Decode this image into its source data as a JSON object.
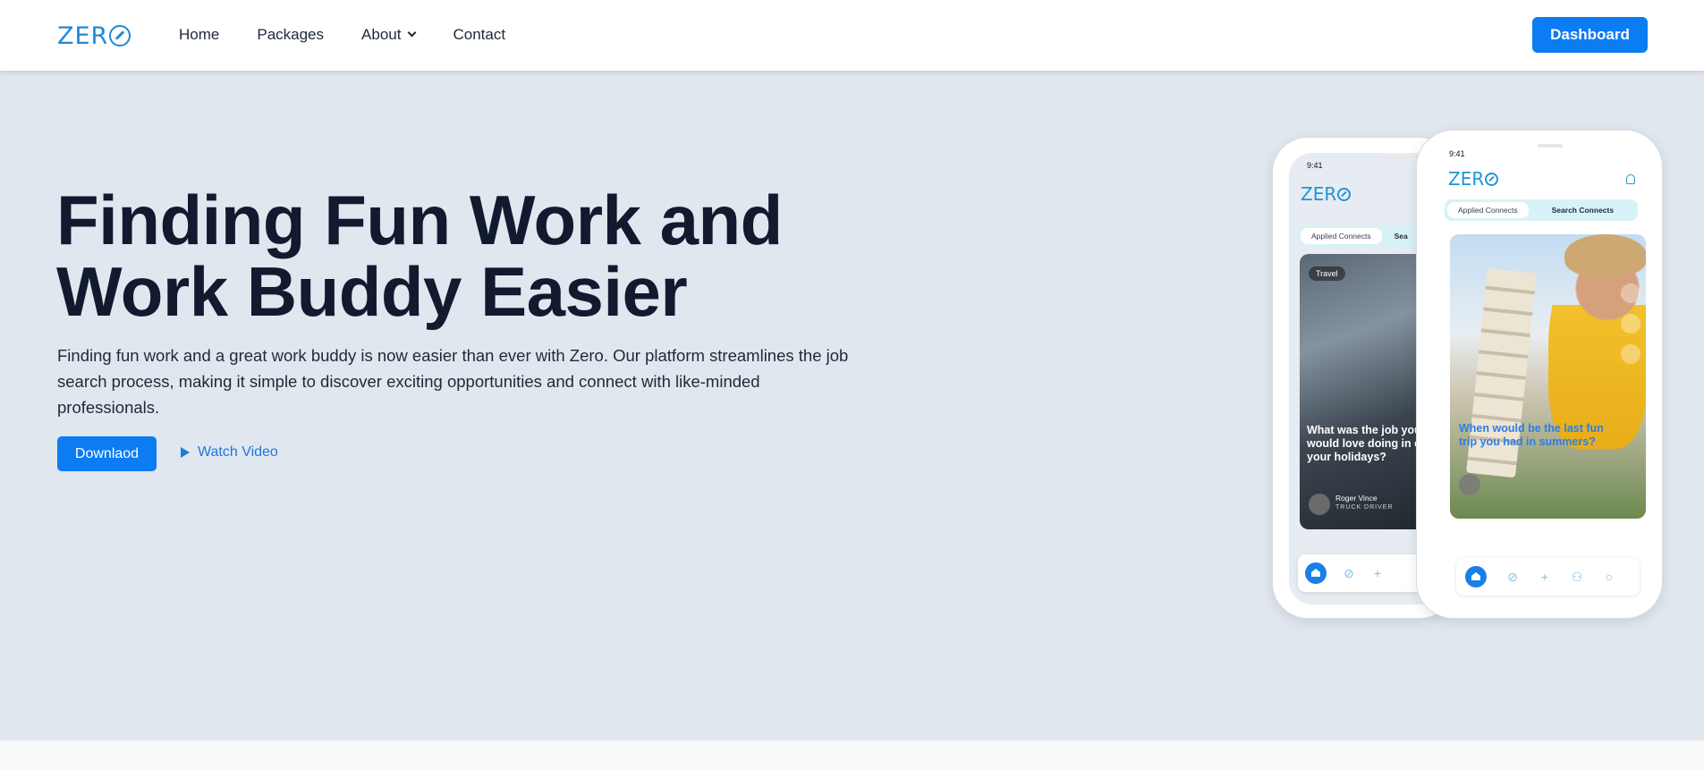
{
  "nav": {
    "logo_text": "ZER",
    "links": [
      "Home",
      "Packages",
      "About",
      "Contact"
    ],
    "dashboard_label": "Dashboard"
  },
  "hero": {
    "headline_line1": "Finding Fun Work and",
    "headline_line2": "Work Buddy Easier",
    "description": "Finding fun work and a great work buddy is now easier than ever with Zero. Our platform streamlines the job search process, making it simple to discover exciting opportunities and connect with like-minded professionals.",
    "download_label": "Downlaod",
    "watch_label": "Watch Video"
  },
  "phone_back": {
    "time": "9:41",
    "logo_text": "ZER",
    "tab_applied": "Applied Connects",
    "tab_search": "Sea",
    "chip": "Travel",
    "question": "What was the job you would love doing in even your holidays?",
    "name": "Roger Vince",
    "role": "TRUCK DRIVER"
  },
  "phone_front": {
    "time": "9:41",
    "logo_text": "ZER",
    "tab_applied": "Applied Connects",
    "tab_search": "Search Connects",
    "question": "When would be the last fun trip you had in summers?"
  },
  "colors": {
    "brand": "#0b7cf2",
    "hero_bg": "#e1e7ef",
    "headline": "#111a2e",
    "logo": "#1d8ad6"
  },
  "icons": {
    "logo_o": "compass-o-icon",
    "about_chevron": "chevron-down-icon",
    "watch": "play-icon"
  }
}
